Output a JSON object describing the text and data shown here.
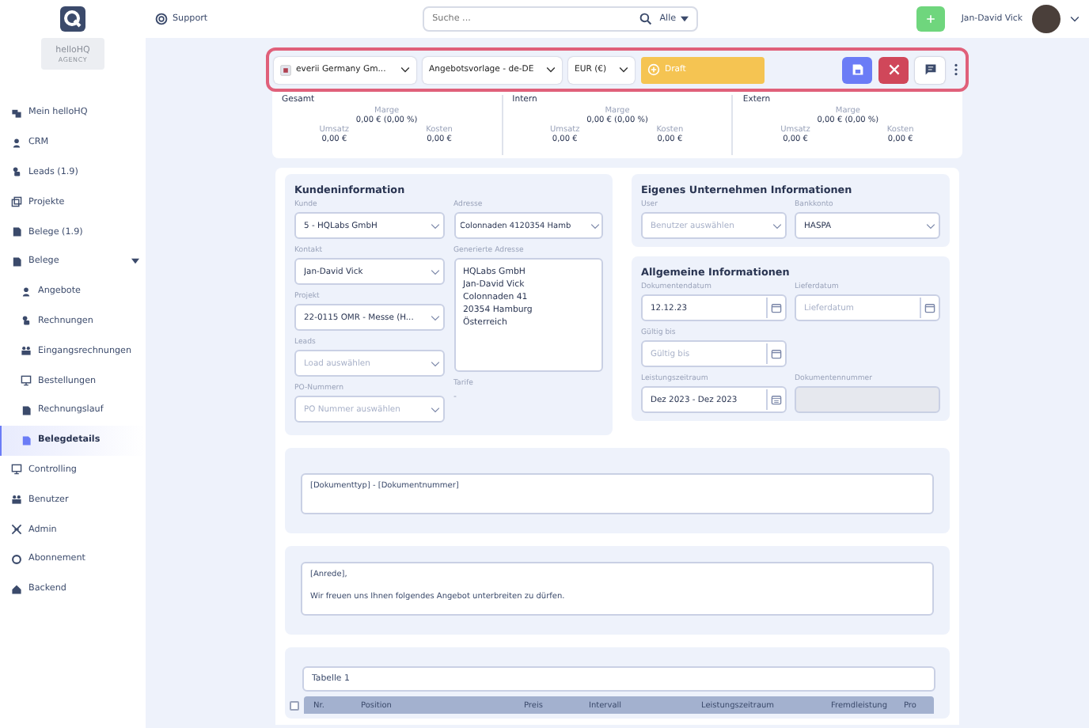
{
  "brand": {
    "title": "helloHQ",
    "subtitle": "AGENCY"
  },
  "sidebar": {
    "items": [
      {
        "label": "Mein helloHQ",
        "selected": false
      },
      {
        "label": "CRM",
        "selected": false
      },
      {
        "label": "Leads (1.9)",
        "selected": false
      },
      {
        "label": "Projekte",
        "selected": false
      },
      {
        "label": "Belege (1.9)",
        "selected": false
      },
      {
        "label": "Belege",
        "selected": false,
        "expanded": true,
        "children": [
          {
            "label": "Angebote",
            "selected": false
          },
          {
            "label": "Rechnungen",
            "selected": false
          },
          {
            "label": "Eingangsrechnungen",
            "selected": false
          },
          {
            "label": "Bestellungen",
            "selected": false
          },
          {
            "label": "Rechnungslauf",
            "selected": false
          },
          {
            "label": "Belegdetails",
            "selected": true
          }
        ]
      },
      {
        "label": "Controlling",
        "selected": false
      },
      {
        "label": "Benutzer",
        "selected": false
      },
      {
        "label": "Admin",
        "selected": false
      },
      {
        "label": "Abonnement",
        "selected": false
      },
      {
        "label": "Backend",
        "selected": false
      }
    ]
  },
  "topbar": {
    "support": "Support",
    "search": {
      "placeholder": "Suche ...",
      "scope": "Alle"
    },
    "user": "Jan-David Vick"
  },
  "toolbar": {
    "company": "everii Germany Gm...",
    "template": "Angebotsvorlage - de-DE",
    "currency": "EUR (€)",
    "status": "Draft"
  },
  "summary": [
    {
      "title": "Gesamt",
      "margin_label": "Marge",
      "margin": "0,00 € (0,00 %)",
      "revenue_label": "Umsatz",
      "revenue": "0,00 €",
      "cost_label": "Kosten",
      "cost": "0,00 €"
    },
    {
      "title": "Intern",
      "margin_label": "Marge",
      "margin": "0,00 € (0,00 %)",
      "revenue_label": "Umsatz",
      "revenue": "0,00 €",
      "cost_label": "Kosten",
      "cost": "0,00 €"
    },
    {
      "title": "Extern",
      "margin_label": "Marge",
      "margin": "0,00 € (0,00 %)",
      "revenue_label": "Umsatz",
      "revenue": "0,00 €",
      "cost_label": "Kosten",
      "cost": "0,00 €"
    }
  ],
  "customer": {
    "title": "Kundeninformation",
    "left": [
      {
        "label": "Kunde",
        "kind": "select",
        "value": "5 - HQLabs GmbH"
      },
      {
        "label": "Kontakt",
        "kind": "select",
        "value": "Jan-David Vick"
      },
      {
        "label": "Projekt",
        "kind": "select",
        "value": "22-0115 OMR - Messe (H..."
      },
      {
        "label": "Leads",
        "kind": "select",
        "placeholder": "Load auswählen"
      },
      {
        "label": "PO-Nummern",
        "kind": "select",
        "placeholder": "PO Nummer auswählen"
      }
    ],
    "address": {
      "label": "Adresse",
      "value": "Colonnaden 4120354 Hamb"
    },
    "generated_address": {
      "label": "Generierte Adresse",
      "lines": [
        "HQLabs GmbH",
        "Jan-David Vick",
        "Colonnaden 41",
        "20354 Hamburg",
        "Österreich"
      ]
    },
    "tariffs": {
      "label": "Tarife",
      "value": "-"
    }
  },
  "company_info": {
    "title": "Eigenes Unternehmen Informationen",
    "fields": [
      {
        "label": "User",
        "kind": "select",
        "placeholder": "Benutzer auswählen"
      },
      {
        "label": "Bankkonto",
        "kind": "select",
        "value": "HASPA"
      }
    ]
  },
  "general_info": {
    "title": "Allgemeine Informationen",
    "fields": [
      {
        "label": "Dokumentendatum",
        "kind": "date",
        "value": "12.12.23"
      },
      {
        "label": "Lieferdatum",
        "kind": "date",
        "placeholder": "Lieferdatum"
      },
      {
        "label": "Gültig bis",
        "kind": "date",
        "placeholder": "Gültig bis"
      },
      {
        "kind": "empty"
      },
      {
        "label": "Leistungszeitraum",
        "kind": "range",
        "value": "Dez 2023 - Dez 2023"
      },
      {
        "label": "Dokumentennummer",
        "kind": "text",
        "disabled": true
      }
    ]
  },
  "title_field": {
    "value": "[Dokumenttyp] - [Dokumentnummer]"
  },
  "intro_field": {
    "lines": [
      "[Anrede],",
      "Wir freuen uns Ihnen folgendes Angebot unterbreiten zu dürfen."
    ]
  },
  "table": {
    "name": "Tabelle 1",
    "checked": false,
    "columns": [
      "Nr.",
      "Position",
      "Preis",
      "Intervall",
      "Leistungszeitraum",
      "Fremdleistung",
      "Pro"
    ]
  }
}
